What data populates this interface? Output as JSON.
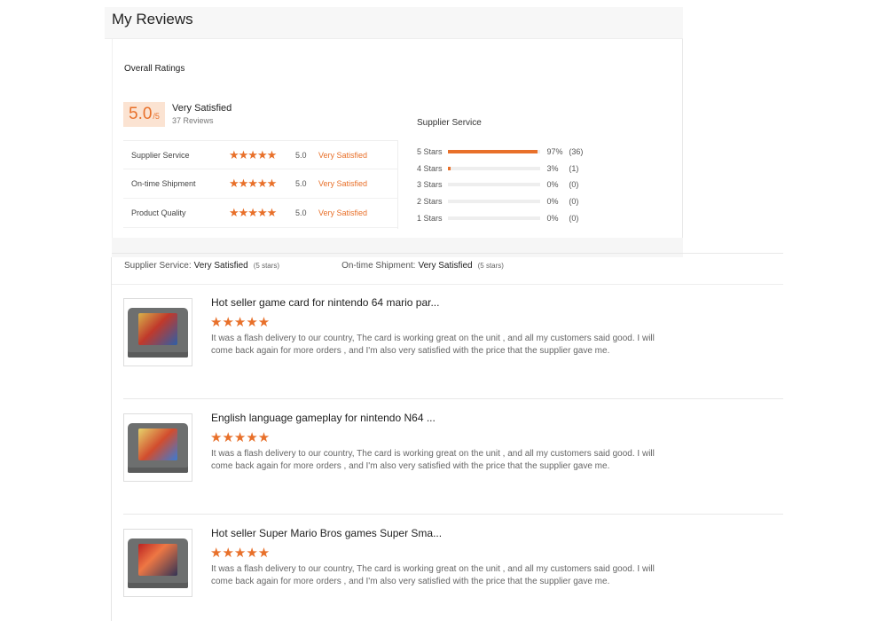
{
  "page": {
    "title": "My Reviews"
  },
  "overall": {
    "heading": "Overall Ratings",
    "score": "5.0",
    "score_denominator": "/5",
    "score_text": "Very Satisfied",
    "review_count": "37 Reviews",
    "accent_color": "#e8702a"
  },
  "ratings": [
    {
      "label": "Supplier Service",
      "stars": "★★★★★",
      "value": "5.0",
      "desc": "Very Satisfied"
    },
    {
      "label": "On-time Shipment",
      "stars": "★★★★★",
      "value": "5.0",
      "desc": "Very Satisfied"
    },
    {
      "label": "Product Quality",
      "stars": "★★★★★",
      "value": "5.0",
      "desc": "Very Satisfied"
    }
  ],
  "distribution": {
    "heading": "Supplier Service",
    "rows": [
      {
        "label": "5 Stars",
        "pct": "97%",
        "count": "(36)",
        "fraction": 0.97
      },
      {
        "label": "4 Stars",
        "pct": "3%",
        "count": "(1)",
        "fraction": 0.03
      },
      {
        "label": "3 Stars",
        "pct": "0%",
        "count": "(0)",
        "fraction": 0
      },
      {
        "label": "2 Stars",
        "pct": "0%",
        "count": "(0)",
        "fraction": 0
      },
      {
        "label": "1 Stars",
        "pct": "0%",
        "count": "(0)",
        "fraction": 0
      }
    ]
  },
  "summary": {
    "supplier_label": "Supplier Service:",
    "supplier_value": "Very Satisfied",
    "supplier_count": "(5 stars)",
    "shipment_label": "On-time Shipment:",
    "shipment_value": "Very Satisfied",
    "shipment_count": "(5 stars)"
  },
  "reviews": [
    {
      "title": "Hot seller game card for nintendo 64 mario par...",
      "stars": "★★★★★",
      "text": "It was a flash delivery to our country, The card is working great on the unit , and all my customers said good. I will come back again for more orders , and I'm also very satisfied with the price that the supplier gave me."
    },
    {
      "title": "English language gameplay for nintendo N64 ...",
      "stars": "★★★★★",
      "text": "It was a flash delivery to our country, The card is working great on the unit , and all my customers said good. I will come back again for more orders , and I'm also very satisfied with the price that the supplier gave me."
    },
    {
      "title": "Hot seller Super Mario Bros games Super Sma...",
      "stars": "★★★★★",
      "text": "It was a flash delivery to our country, The card is working great on the unit , and all my customers said good. I will come back again for more orders , and I'm also very satisfied with the price that the supplier gave me."
    }
  ]
}
